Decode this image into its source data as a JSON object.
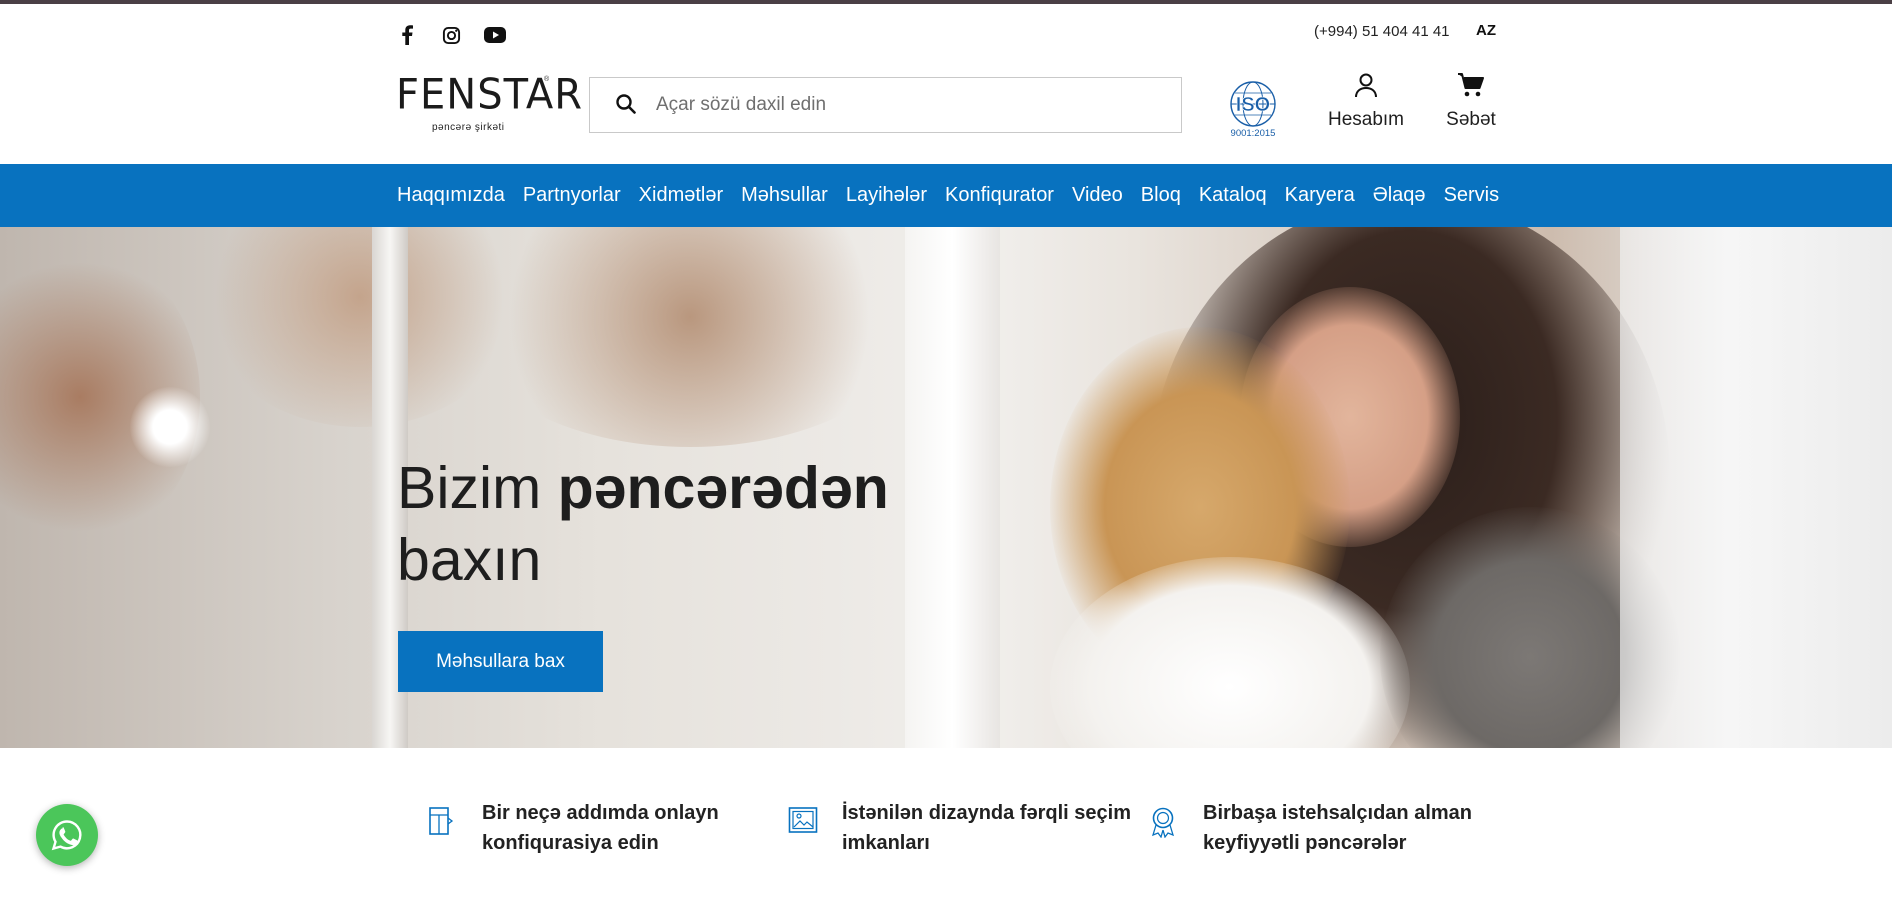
{
  "header": {
    "socials": [
      {
        "icon": "facebook-icon"
      },
      {
        "icon": "instagram-icon"
      },
      {
        "icon": "youtube-icon"
      }
    ],
    "phone": "(+994) 51 404 41 41",
    "language": "AZ",
    "logo": {
      "name": "FENSTAR",
      "tagline": "pəncərə şirkəti"
    },
    "search": {
      "placeholder": "Açar sözü daxil edin",
      "value": ""
    },
    "iso": {
      "label": "ISO",
      "standard": "9001:2015"
    },
    "account_label": "Hesabım",
    "cart_label": "Səbət"
  },
  "nav": {
    "items": [
      "Haqqımızda",
      "Partnyorlar",
      "Xidmətlər",
      "Məhsullar",
      "Layihələr",
      "Konfiqurator",
      "Video",
      "Bloq",
      "Kataloq",
      "Karyera",
      "Əlaqə",
      "Servis"
    ]
  },
  "hero": {
    "title_regular": "Bizim ",
    "title_bold": "pəncərədən",
    "title_line2": "baxın",
    "button_label": "Məhsullara bax"
  },
  "features": [
    {
      "icon": "window-config-icon",
      "text": "Bir neçə addımda onlayn konfiqurasiya edin"
    },
    {
      "icon": "picture-design-icon",
      "text": "İstənilən dizaynda fərqli seçim imkanları"
    },
    {
      "icon": "quality-badge-icon",
      "text": "Birbaşa istehsalçıdan alman keyfiyyətli pəncərələr"
    }
  ],
  "colors": {
    "brand_blue": "#0872bf",
    "whatsapp_green": "#4bc65a"
  }
}
